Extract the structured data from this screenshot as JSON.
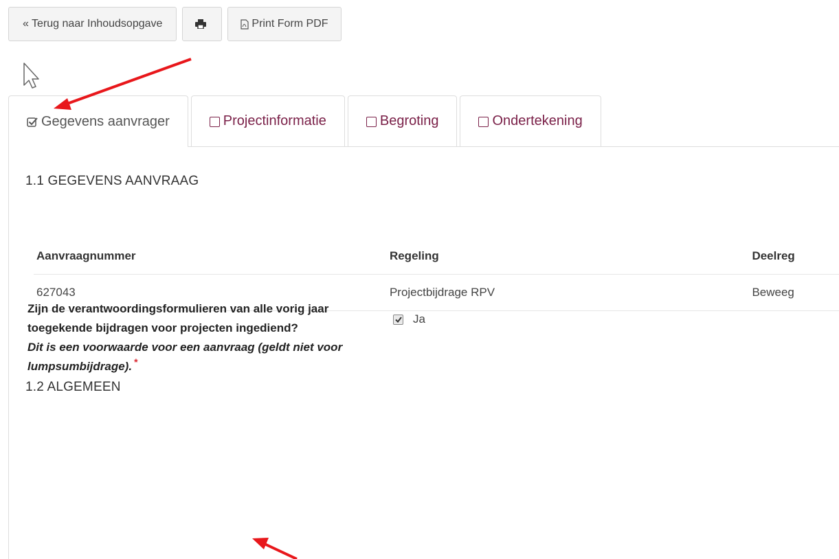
{
  "toolbar": {
    "back_label": "« Terug naar Inhoudsopgave",
    "print_icon": "printer-icon",
    "pdf_label": "Print Form PDF",
    "pdf_icon": "pdf-file-icon"
  },
  "tabs": [
    {
      "label": "Gegevens aanvrager",
      "checked": true
    },
    {
      "label": "Projectinformatie",
      "checked": false
    },
    {
      "label": "Begroting",
      "checked": false
    },
    {
      "label": "Ondertekening",
      "checked": false
    }
  ],
  "section1": {
    "title": "1.1 GEGEVENS AANVRAAG",
    "columns": [
      "Aanvraagnummer",
      "Regeling",
      "Deelreg"
    ],
    "row": [
      "627043",
      "Projectbijdrage RPV",
      "Beweeg"
    ]
  },
  "section2": {
    "title": "1.2 ALGEMEEN",
    "question": "Zijn de verantwoordingsformulieren van alle vorig jaar toegekende bijdragen voor projecten ingediend?",
    "note": "Dit is een voorwaarde voor een aanvraag (geldt niet voor lumpsumbijdrage).",
    "required_mark": "*",
    "answer_label": "Ja",
    "answer_checked": true
  },
  "colors": {
    "tab_text": "#7a2048",
    "required": "#d9262f",
    "annotation_arrow": "#e8171b"
  }
}
